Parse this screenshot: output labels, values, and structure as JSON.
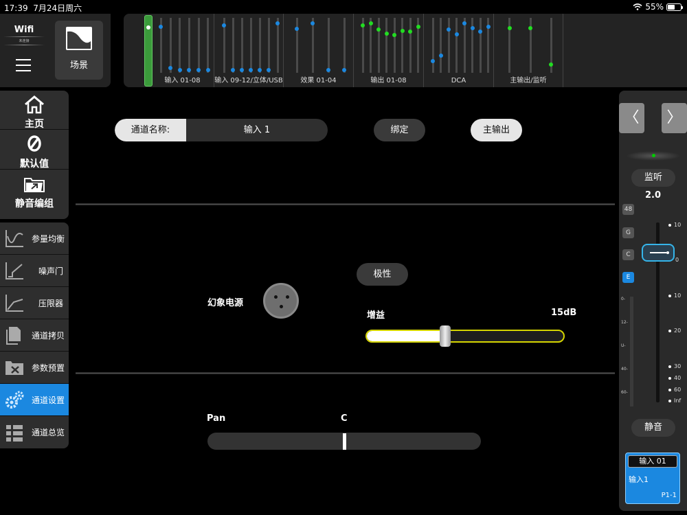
{
  "status_bar": {
    "time": "17:39",
    "date": "7月24日周六",
    "battery": "55%",
    "battery_level": 0.55
  },
  "top_left": {
    "wifi_label": "Wifi",
    "wifi_sub": "未连接",
    "scene_label": "场景"
  },
  "overview": {
    "groups": [
      {
        "name": "输入 01-08"
      },
      {
        "name": "输入 09-12/立体/USB"
      },
      {
        "name": "效果 01-04"
      },
      {
        "name": "输出 01-08"
      },
      {
        "name": "DCA"
      },
      {
        "name": "主输出/监听"
      }
    ]
  },
  "sidebar": {
    "primary": [
      {
        "label": "主页",
        "icon": "home-icon"
      },
      {
        "label": "默认值",
        "icon": "reset-icon"
      },
      {
        "label": "静音编组",
        "icon": "mute-group-icon"
      }
    ],
    "items": [
      {
        "label": "参量均衡",
        "icon": "eq-icon"
      },
      {
        "label": "噪声门",
        "icon": "gate-icon"
      },
      {
        "label": "压限器",
        "icon": "compressor-icon"
      },
      {
        "label": "通道拷贝",
        "icon": "copy-icon"
      },
      {
        "label": "参数预置",
        "icon": "preset-icon"
      },
      {
        "label": "通道设置",
        "icon": "settings-icon",
        "active": true
      },
      {
        "label": "通道总览",
        "icon": "overview-icon"
      }
    ]
  },
  "channel": {
    "name_label": "通道名称:",
    "name_value": "输入 1",
    "bind_label": "绑定",
    "main_out_label": "主输出"
  },
  "settings": {
    "phantom_label": "幻象电源",
    "polarity_label": "极性",
    "gain_label": "增益",
    "gain_value": "15dB",
    "gain_fraction": 0.4,
    "pan_label": "Pan",
    "pan_value": "C",
    "pan_position": 0.5
  },
  "right_panel": {
    "prev_icon": "chevron-left-icon",
    "next_icon": "chevron-right-icon",
    "monitor_label": "监听",
    "monitor_value": "2.0",
    "tags": [
      "48",
      "G",
      "C",
      "E"
    ],
    "meter_scale": [
      "0-",
      "12-",
      "U-",
      "40-",
      "60-"
    ],
    "fader_marks": [
      "10",
      "0",
      "10",
      "20",
      "30",
      "40",
      "60",
      "Inf"
    ],
    "mute_label": "静音",
    "channel_card": {
      "title": "输入 01",
      "name": "输入1",
      "code": "P1-1"
    }
  },
  "colors": {
    "accent": "#1b88e0",
    "gain_border": "#d6d600",
    "dot_blue": "#1b88e0",
    "dot_green": "#22dd22"
  }
}
